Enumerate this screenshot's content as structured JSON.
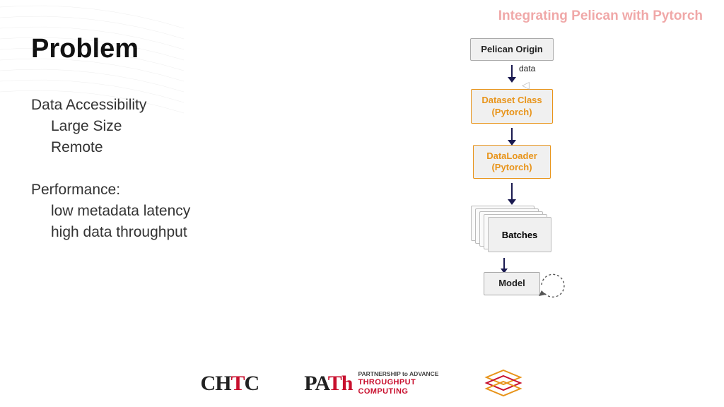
{
  "header": {
    "label": "Integrating Pelican with Pytorch"
  },
  "title": "Problem",
  "sections": [
    {
      "head": "Data Accessibility",
      "items": [
        "Large Size",
        "Remote"
      ]
    },
    {
      "head": "Performance:",
      "items": [
        "low metadata latency",
        "high data throughput"
      ]
    }
  ],
  "diagram": {
    "node1": "Pelican Origin",
    "arrow1_label": "data",
    "node2_line1": "Dataset Class",
    "node2_line2": "(Pytorch)",
    "node3_line1": "DataLoader",
    "node3_line2": "(Pytorch)",
    "node4": "Batches",
    "node5": "Model"
  },
  "footer": {
    "chtc": {
      "ch": "CH",
      "t": "T",
      "c": "C"
    },
    "path": {
      "pa": "PA",
      "th": "Th",
      "tag1": "PARTNERSHIP to ADVANCE",
      "tag2": "THROUGHPUT",
      "tag3": "COMPUTING"
    }
  }
}
